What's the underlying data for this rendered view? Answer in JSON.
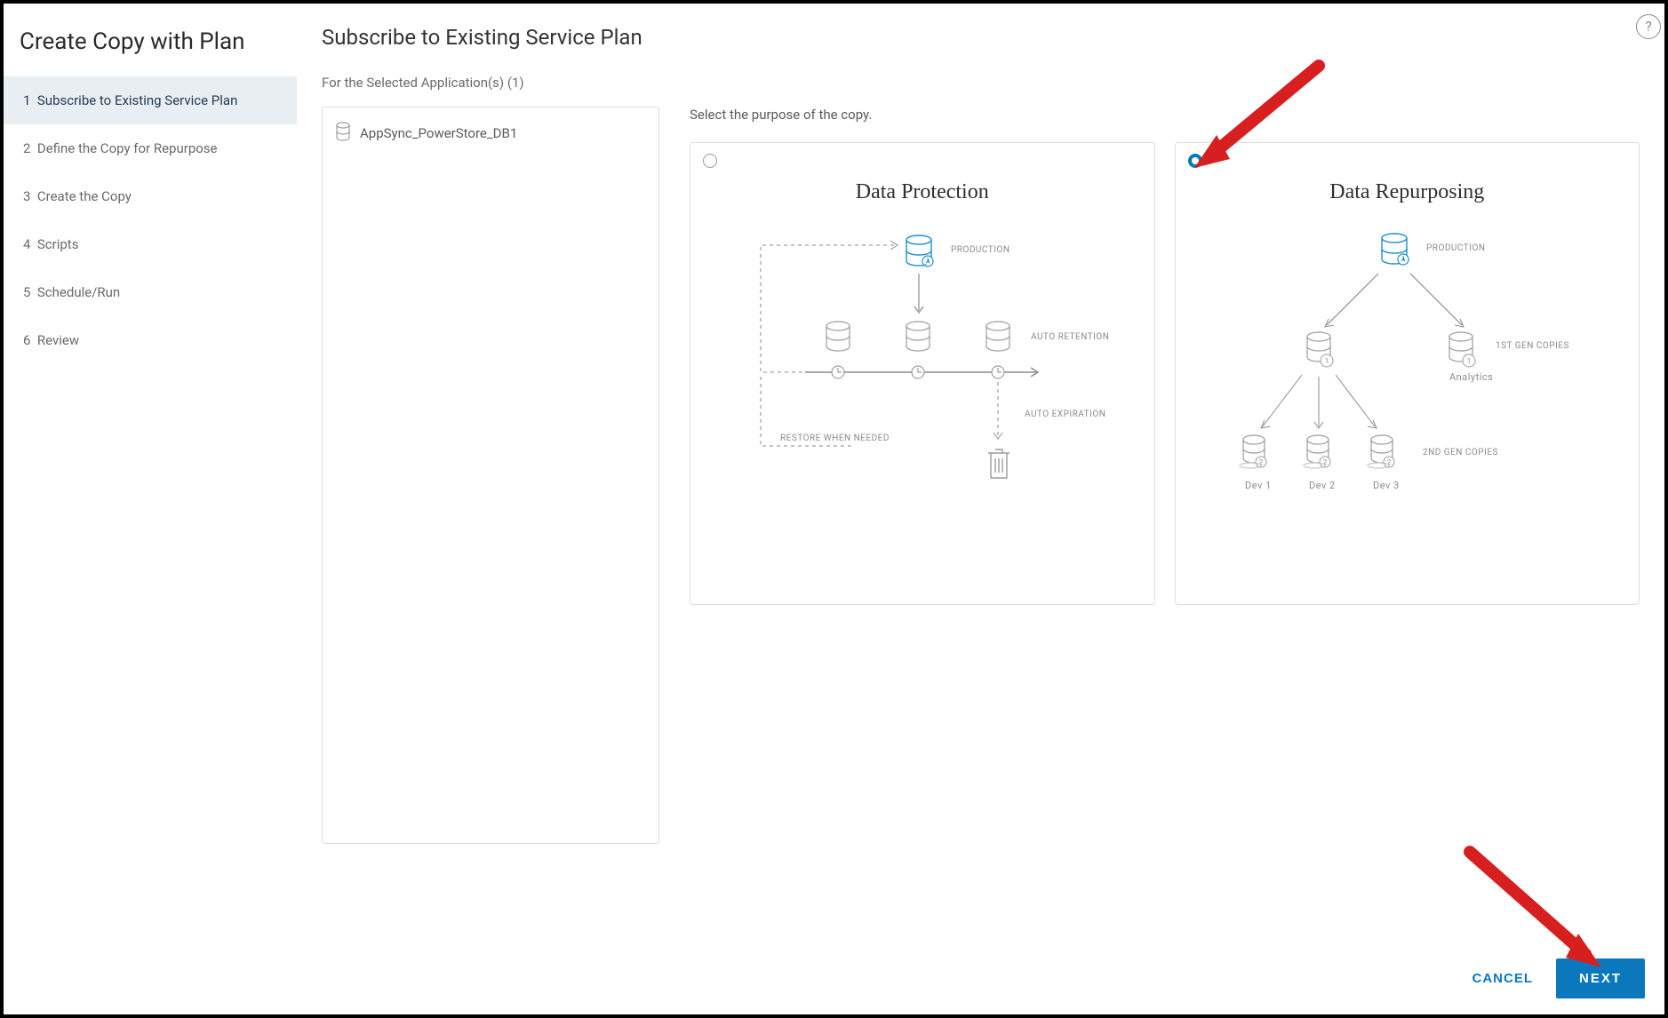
{
  "wizard": {
    "title": "Create Copy with Plan",
    "steps": [
      {
        "num": "1",
        "label": "Subscribe to Existing Service Plan"
      },
      {
        "num": "2",
        "label": "Define the Copy for Repurpose"
      },
      {
        "num": "3",
        "label": "Create the Copy"
      },
      {
        "num": "4",
        "label": "Scripts"
      },
      {
        "num": "5",
        "label": "Schedule/Run"
      },
      {
        "num": "6",
        "label": "Review"
      }
    ],
    "active_index": 0
  },
  "page": {
    "title": "Subscribe to Existing Service Plan",
    "selected_apps_label": "For the Selected Application(s) (1)",
    "purpose_label": "Select the purpose of the copy."
  },
  "applications": [
    {
      "name": "AppSync_PowerStore_DB1"
    }
  ],
  "cards": {
    "protection": {
      "title": "Data Protection",
      "labels": {
        "production": "PRODUCTION",
        "auto_retention": "AUTO RETENTION",
        "auto_expiration": "AUTO EXPIRATION",
        "restore": "RESTORE WHEN NEEDED"
      },
      "selected": false
    },
    "repurposing": {
      "title": "Data Repurposing",
      "labels": {
        "production": "PRODUCTION",
        "first_gen": "1ST GEN COPIES",
        "analytics": "Analytics",
        "second_gen": "2ND GEN COPIES",
        "dev1": "Dev 1",
        "dev2": "Dev 2",
        "dev3": "Dev 3"
      },
      "selected": true
    }
  },
  "footer": {
    "cancel": "CANCEL",
    "next": "NEXT"
  }
}
